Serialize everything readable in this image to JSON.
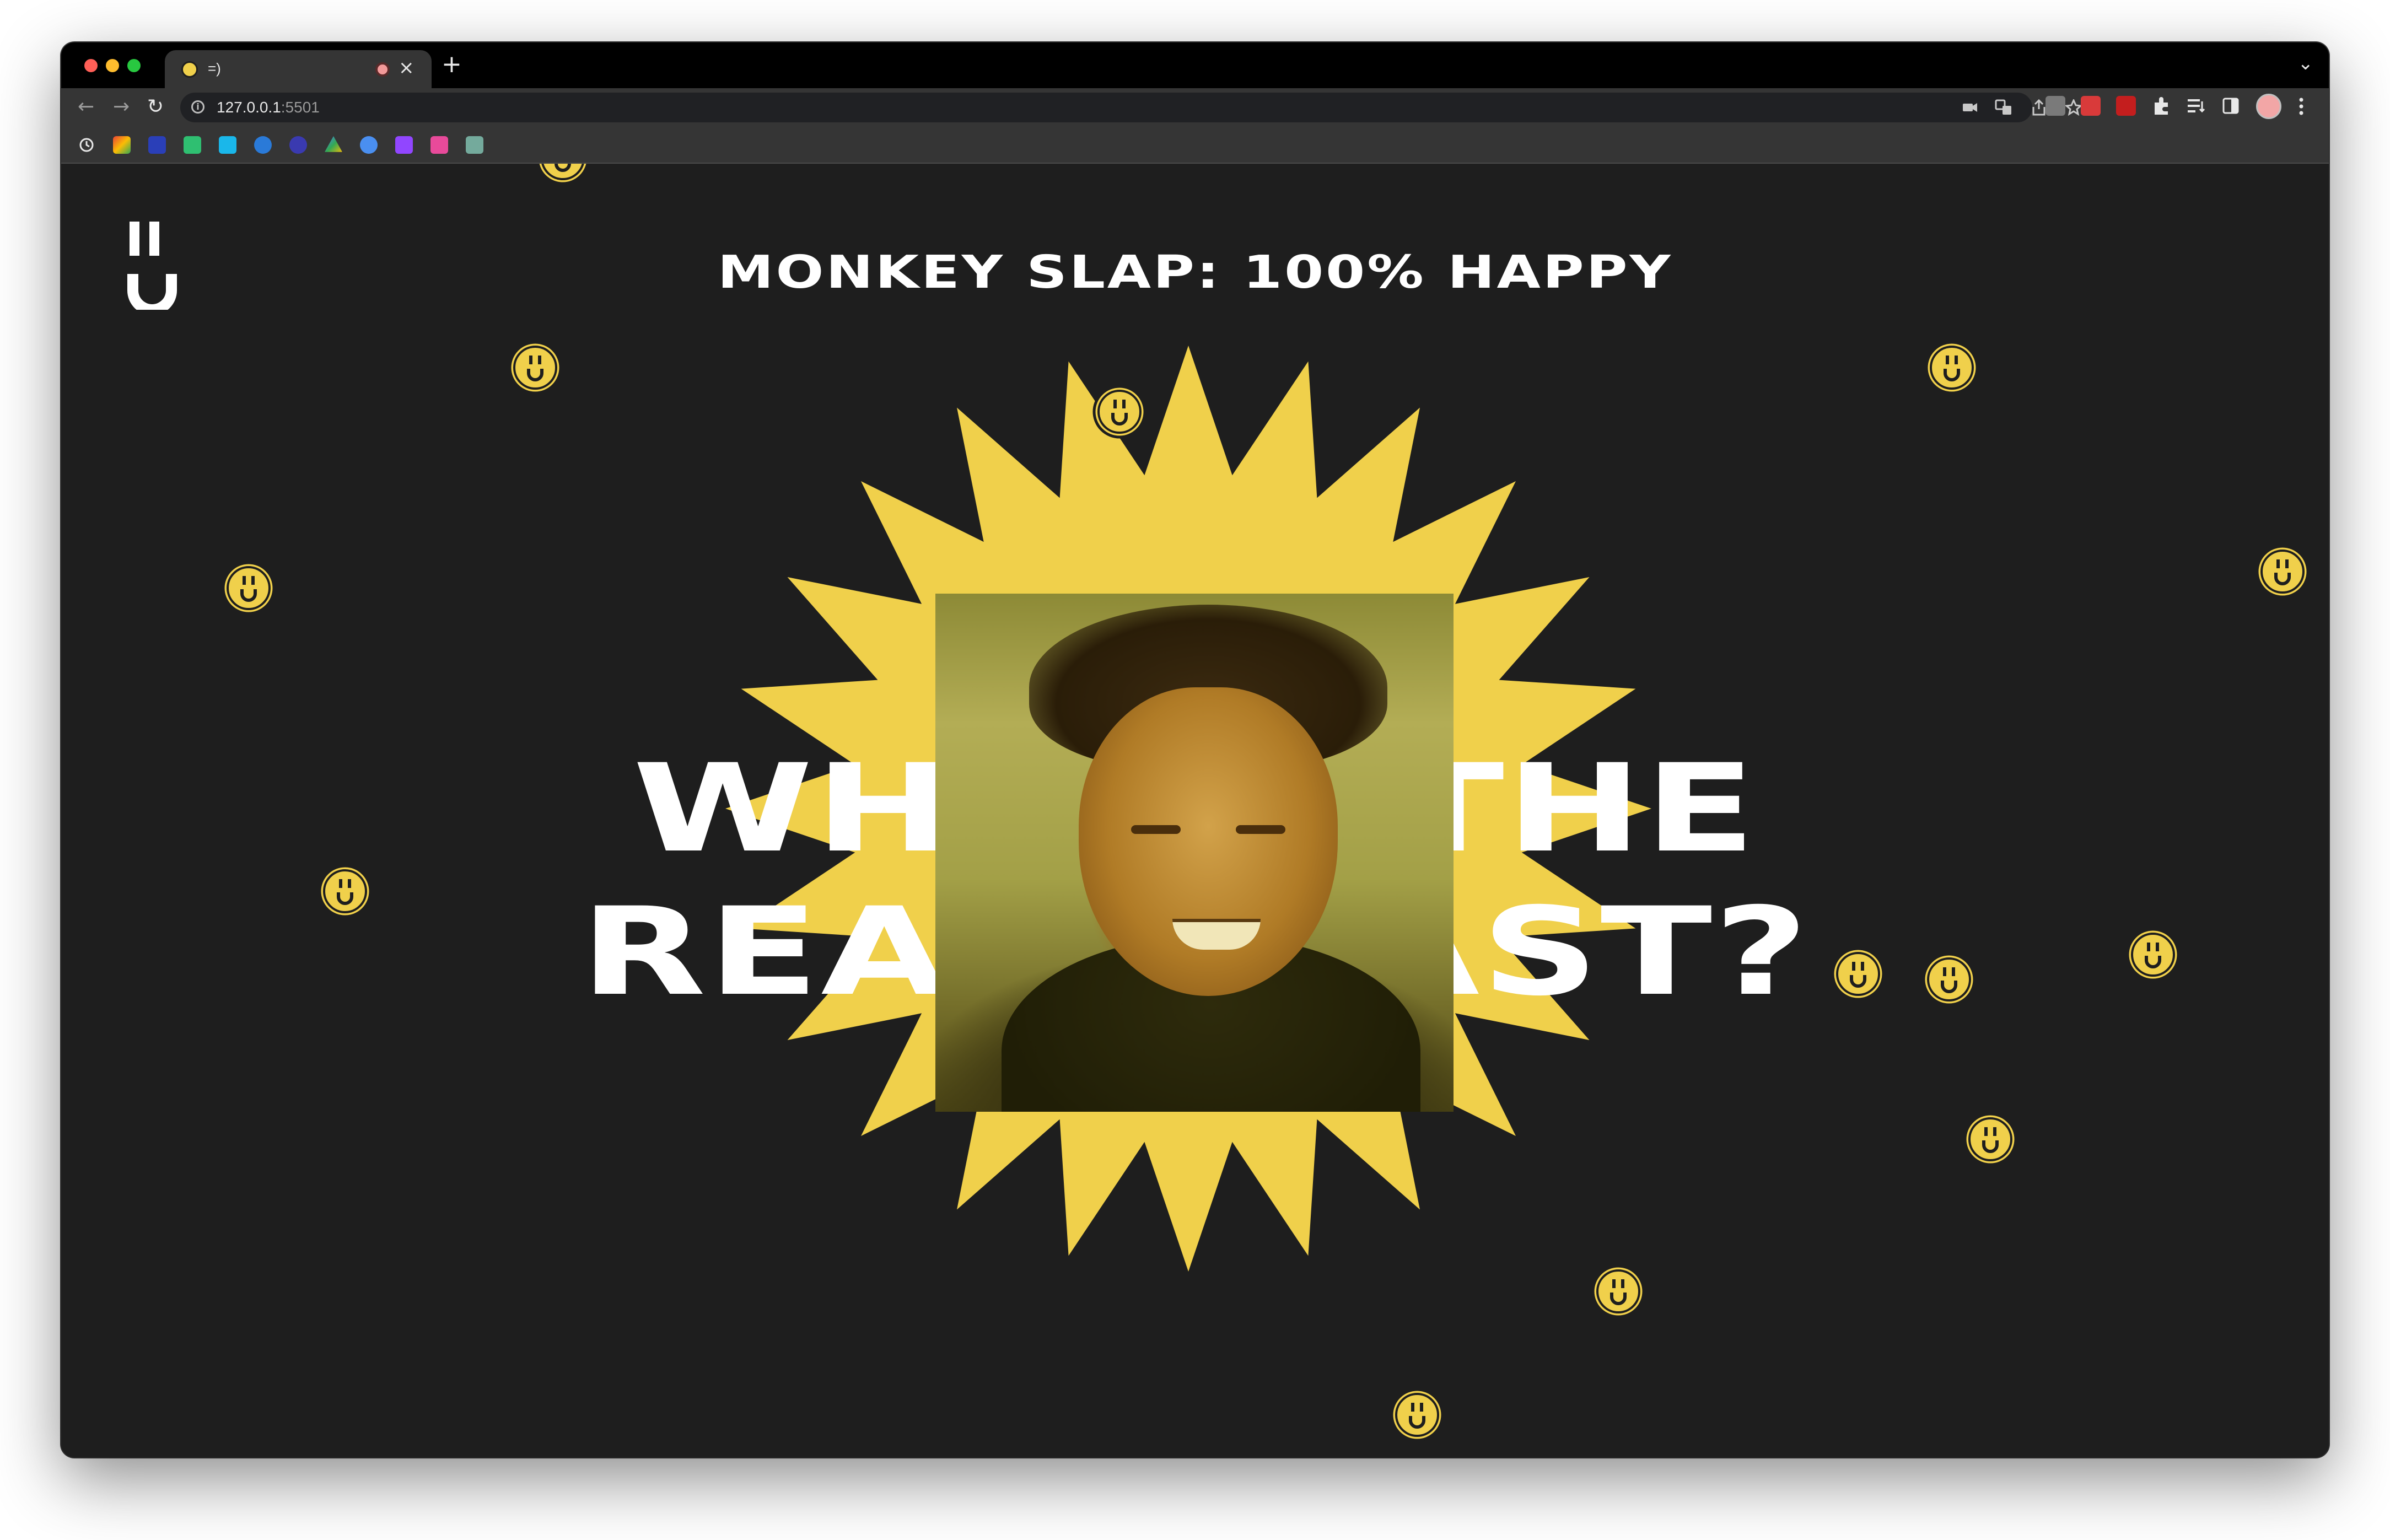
{
  "browser": {
    "tab_title": "=)",
    "tab_close": "×",
    "new_tab": "+",
    "tab_dropdown": "⌄",
    "url_host": "127.0.0.1",
    "url_port": ":5501",
    "nav_back": "←",
    "nav_forward": "→",
    "nav_reload": "↻"
  },
  "page": {
    "heading": "MONKEY SLAP: 100% HAPPY",
    "big_text_line1": "WHO IS THE",
    "big_text_line2": "REAL BEAST?",
    "accent_color": "#f0d04b",
    "background_color": "#1e1e1e"
  }
}
